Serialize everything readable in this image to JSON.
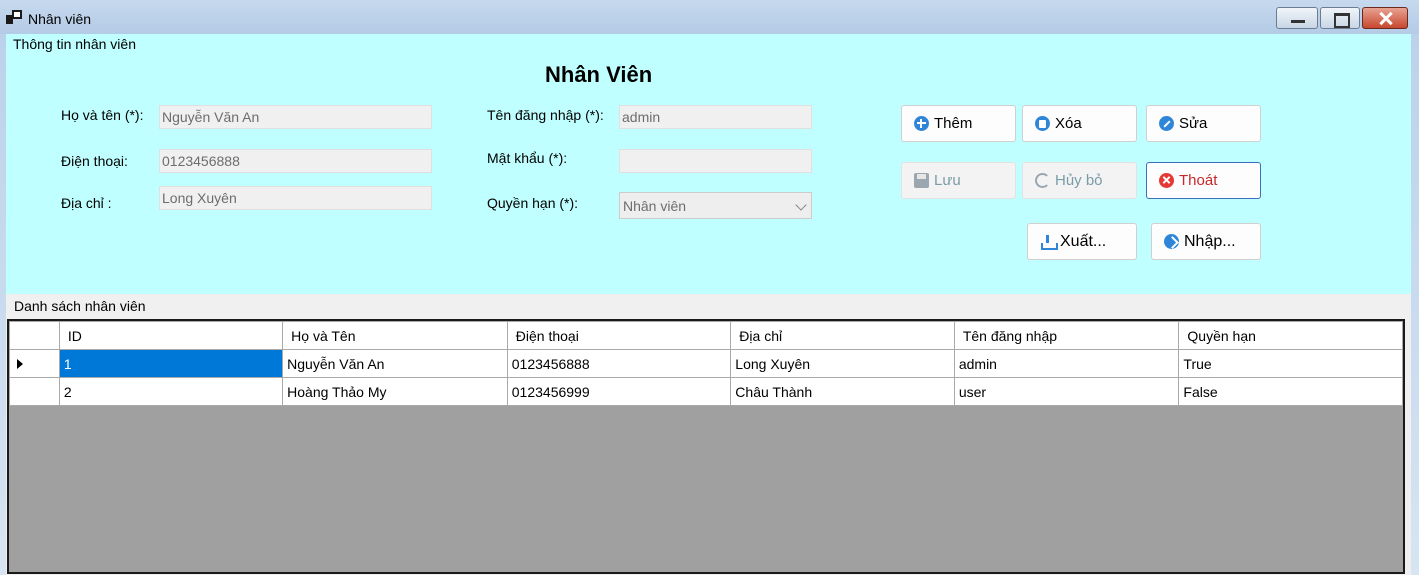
{
  "window": {
    "title": "Nhân viên"
  },
  "info_group": {
    "caption": "Thông tin nhân viên",
    "form_title": "Nhân Viên"
  },
  "form": {
    "fullname": {
      "label": "Họ và tên (*):",
      "value": "Nguyễn Văn An"
    },
    "phone": {
      "label": "Điện thoại:",
      "value": "0123456888"
    },
    "address": {
      "label": "Địa chỉ :",
      "value": "Long Xuyên"
    },
    "username": {
      "label": "Tên đăng nhập (*):",
      "value": "admin"
    },
    "password": {
      "label": "Mật khẩu (*):",
      "value": ""
    },
    "role": {
      "label": "Quyền hạn (*):",
      "selected": "Nhân viên"
    }
  },
  "buttons": {
    "add": "Thêm",
    "delete": "Xóa",
    "edit": "Sửa",
    "save": "Lưu",
    "cancel": "Hủy bỏ",
    "exit": "Thoát",
    "export": "Xuất...",
    "import": "Nhập..."
  },
  "list_group": {
    "caption": "Danh sách nhân viên",
    "columns": [
      "ID",
      "Họ và Tên",
      "Điện thoại",
      "Địa chỉ",
      "Tên đăng nhập",
      "Quyền hạn"
    ],
    "rows": [
      [
        "1",
        "Nguyễn Văn An",
        "0123456888",
        "Long Xuyên",
        "admin",
        "True"
      ],
      [
        "2",
        "Hoàng Thảo My",
        "0123456999",
        "Châu Thành",
        "user",
        "False"
      ]
    ]
  },
  "colors": {
    "panel_bg": "#c0ffff",
    "selection": "#0078d7",
    "grid_empty": "#a0a0a0"
  }
}
